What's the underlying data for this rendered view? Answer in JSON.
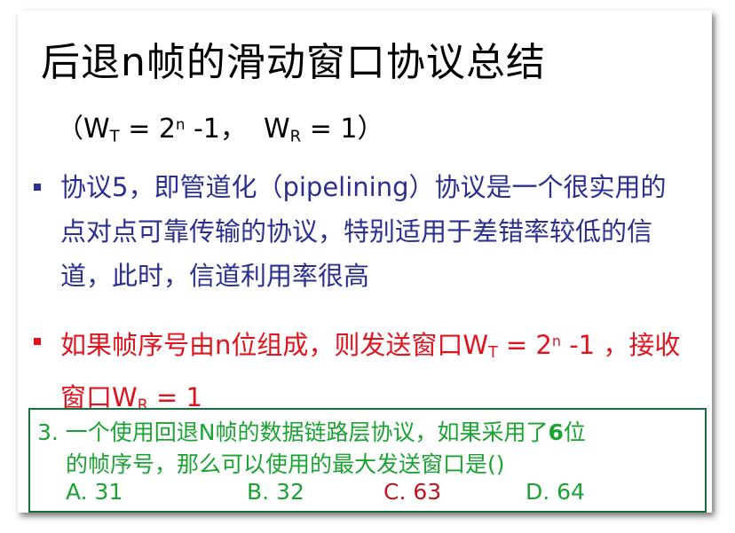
{
  "title": "后退n帧的滑动窗口协议总结",
  "formula": {
    "open": "（",
    "wt_letter": "W",
    "wt_sub": "T",
    "wt_eq": " = 2",
    "wt_exp": "n",
    "wt_tail": " -1，",
    "wr_letter": "W",
    "wr_sub": "R",
    "wr_eq": " = 1",
    "close": "）"
  },
  "bullets": [
    {
      "text": "协议5，即管道化（pipelining）协议是一个很实用的点对点可靠传输的协议，特别适用于差错率较低的信道，此时，信道利用率很高",
      "color": "#2b2f8f"
    },
    {
      "text_pre": "如果帧序号由n位组成，则发送窗口W",
      "wt_sub": "T",
      "wt_eq": " = 2",
      "wt_exp": "n",
      "wt_tail": " -1 ，接收窗口W",
      "wr_sub": "R",
      "wr_eq": " = 1",
      "color": "#e0141e"
    }
  ],
  "question": {
    "line1_pre": "3. 一个使用回退N帧的数据链路层协议，如果采用了",
    "line1_bold": "6",
    "line1_post": "位",
    "line2": "的帧序号，那么可以使用的最大发送窗口是()",
    "options": {
      "a": "A. 31",
      "b": "B. 32",
      "c": "C. 63",
      "d": "D. 64"
    },
    "color": "#1aa332",
    "answer_color": "#c0161e"
  }
}
